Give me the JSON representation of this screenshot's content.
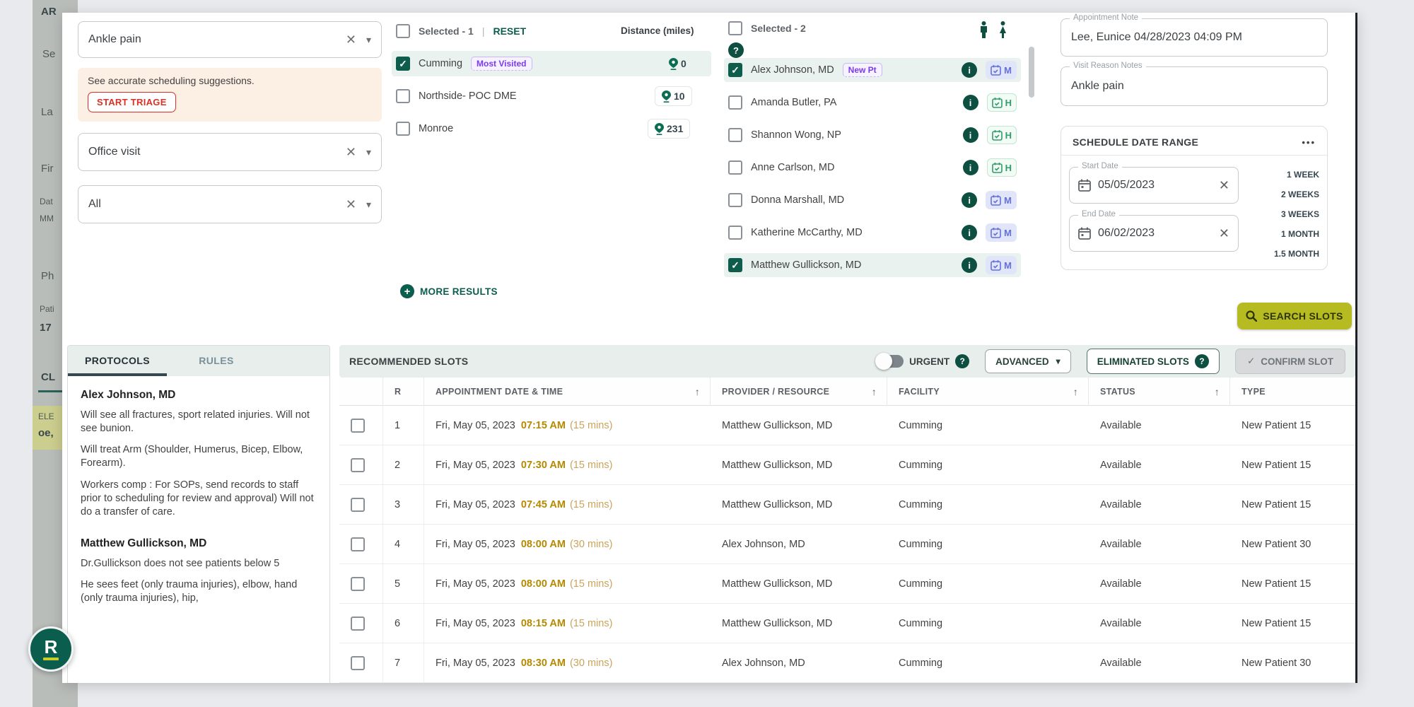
{
  "icons": {
    "clear": "✕",
    "dropdown": "▾",
    "check": "✓",
    "plus": "+",
    "info": "i",
    "question": "?",
    "sort": "↑",
    "ellipsis": "•••"
  },
  "background_fragments": [
    "AR",
    "Se",
    "La",
    "Fir",
    "Dat",
    "MM",
    "Ph",
    "Pati",
    "17",
    "CL",
    "ELE",
    "oe,"
  ],
  "filters": {
    "chief_complaint": "Ankle pain",
    "triage_text": "See accurate scheduling suggestions.",
    "triage_button": "START TRIAGE",
    "visit_type": "Office visit",
    "provider_scope": "All"
  },
  "locations": {
    "selected_label": "Selected - 1",
    "reset_label": "RESET",
    "distance_header": "Distance (miles)",
    "more_results": "MORE RESULTS",
    "items": [
      {
        "name": "Cumming",
        "badge": "Most Visited",
        "distance": "0"
      },
      {
        "name": "Northside- POC DME",
        "distance": "10"
      },
      {
        "name": "Monroe",
        "distance": "231"
      }
    ]
  },
  "providers": {
    "selected_label": "Selected - 2",
    "items": [
      {
        "name": "Alex Johnson, MD",
        "badge": "New Pt",
        "cal_letter": "M"
      },
      {
        "name": "Amanda Butler, PA",
        "cal_letter": "H"
      },
      {
        "name": "Shannon Wong, NP",
        "cal_letter": "H"
      },
      {
        "name": "Anne Carlson, MD",
        "cal_letter": "H"
      },
      {
        "name": "Donna Marshall, MD",
        "cal_letter": "M"
      },
      {
        "name": "Katherine McCarthy, MD",
        "cal_letter": "M"
      },
      {
        "name": "Matthew Gullickson, MD",
        "cal_letter": "M"
      }
    ]
  },
  "notes": {
    "appointment_note_label": "Appointment Note",
    "appointment_note": "Lee, Eunice 04/28/2023 04:09 PM",
    "visit_reason_label": "Visit Reason Notes",
    "visit_reason": "Ankle pain"
  },
  "date_range": {
    "title": "SCHEDULE DATE RANGE",
    "start_label": "Start Date",
    "start_value": "05/05/2023",
    "end_label": "End Date",
    "end_value": "06/02/2023",
    "quick_options": [
      "1 WEEK",
      "2 WEEKS",
      "3 WEEKS",
      "1 MONTH",
      "1.5 MONTH"
    ]
  },
  "search_button": "SEARCH SLOTS",
  "protocols_panel": {
    "tabs": [
      "PROTOCOLS",
      "RULES"
    ],
    "entries": [
      {
        "name": "Alex Johnson, MD",
        "notes": [
          "Will see all fractures, sport related injuries. Will not see bunion.",
          "Will treat Arm (Shoulder, Humerus, Bicep, Elbow, Forearm).",
          "Workers comp : For SOPs, send records to staff prior to scheduling for review and approval) Will not do a transfer of care."
        ]
      },
      {
        "name": "Matthew Gullickson, MD",
        "notes": [
          "Dr.Gullickson does not see patients below 5",
          "He sees feet (only trauma injuries), elbow, hand (only trauma injuries), hip,"
        ]
      }
    ]
  },
  "slots": {
    "title": "RECOMMENDED SLOTS",
    "urgent_label": "URGENT",
    "advanced_label": "ADVANCED",
    "eliminated_label": "ELIMINATED SLOTS",
    "confirm_label": "CONFIRM SLOT",
    "columns": {
      "rank": "R",
      "datetime": "APPOINTMENT DATE & TIME",
      "provider": "PROVIDER / RESOURCE",
      "facility": "FACILITY",
      "status": "STATUS",
      "type": "TYPE"
    },
    "rows": [
      {
        "r": "1",
        "date": "Fri, May 05, 2023",
        "time": "07:15 AM",
        "duration": "(15 mins)",
        "provider": "Matthew Gullickson, MD",
        "facility": "Cumming",
        "status": "Available",
        "type": "New Patient 15"
      },
      {
        "r": "2",
        "date": "Fri, May 05, 2023",
        "time": "07:30 AM",
        "duration": "(15 mins)",
        "provider": "Matthew Gullickson, MD",
        "facility": "Cumming",
        "status": "Available",
        "type": "New Patient 15"
      },
      {
        "r": "3",
        "date": "Fri, May 05, 2023",
        "time": "07:45 AM",
        "duration": "(15 mins)",
        "provider": "Matthew Gullickson, MD",
        "facility": "Cumming",
        "status": "Available",
        "type": "New Patient 15"
      },
      {
        "r": "4",
        "date": "Fri, May 05, 2023",
        "time": "08:00 AM",
        "duration": "(30 mins)",
        "provider": "Alex Johnson, MD",
        "facility": "Cumming",
        "status": "Available",
        "type": "New Patient 30"
      },
      {
        "r": "5",
        "date": "Fri, May 05, 2023",
        "time": "08:00 AM",
        "duration": "(15 mins)",
        "provider": "Matthew Gullickson, MD",
        "facility": "Cumming",
        "status": "Available",
        "type": "New Patient 15"
      },
      {
        "r": "6",
        "date": "Fri, May 05, 2023",
        "time": "08:15 AM",
        "duration": "(15 mins)",
        "provider": "Matthew Gullickson, MD",
        "facility": "Cumming",
        "status": "Available",
        "type": "New Patient 15"
      },
      {
        "r": "7",
        "date": "Fri, May 05, 2023",
        "time": "08:30 AM",
        "duration": "(30 mins)",
        "provider": "Alex Johnson, MD",
        "facility": "Cumming",
        "status": "Available",
        "type": "New Patient 30"
      }
    ]
  },
  "fab_letter": "R",
  "colors": {
    "accent_green": "#0b5d4e",
    "highlight_row": "#e9f2ee",
    "search_button": "#b6bb22",
    "time_gold": "#b58900",
    "badge_purple": "#7c3aed",
    "triage_red": "#d93025"
  }
}
